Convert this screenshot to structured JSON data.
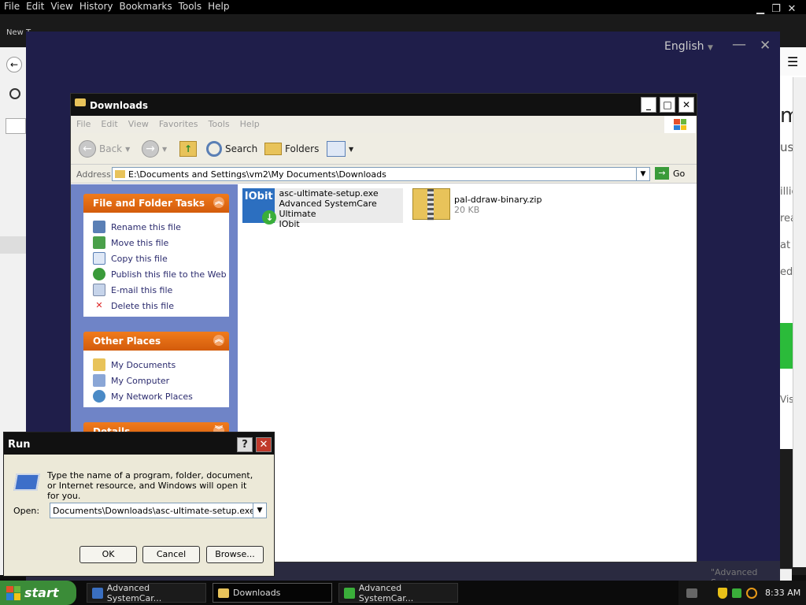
{
  "browser": {
    "menu": [
      "File",
      "Edit",
      "View",
      "History",
      "Bookmarks",
      "Tools",
      "Help"
    ],
    "new_tab_label": "New T"
  },
  "installer": {
    "language": "English",
    "language_arrow": "▼",
    "minimize": "—",
    "close": "✕"
  },
  "explorer": {
    "title": "Downloads",
    "menu": [
      "File",
      "Edit",
      "View",
      "Favorites",
      "Tools",
      "Help"
    ],
    "toolbar": {
      "back": "Back",
      "search": "Search",
      "folders": "Folders"
    },
    "address_label": "Address",
    "address_value": "E:\\Documents and Settings\\vm2\\My Documents\\Downloads",
    "go_label": "Go",
    "file_tasks": {
      "title": "File and Folder Tasks",
      "items": [
        "Rename this file",
        "Move this file",
        "Copy this file",
        "Publish this file to the Web",
        "E-mail this file",
        "Delete this file"
      ]
    },
    "other_places": {
      "title": "Other Places",
      "items": [
        "My Documents",
        "My Computer",
        "My Network Places"
      ]
    },
    "details_title": "Details",
    "files": [
      {
        "name": "asc-ultimate-setup.exe",
        "line2": "Advanced SystemCare Ultimate",
        "line3": "IObit",
        "icon_text": "IObit"
      },
      {
        "name": "pal-ddraw-binary.zip",
        "line2": "20 KB"
      }
    ]
  },
  "run_dialog": {
    "title": "Run",
    "help": "?",
    "close": "✕",
    "message": "Type the name of a program, folder, document, or Internet resource, and Windows will open it for you.",
    "open_label": "Open:",
    "open_value": "Documents\\Downloads\\asc-ultimate-setup.exe\" /qu",
    "ok": "OK",
    "cancel": "Cancel",
    "browse": "Browse..."
  },
  "taskbar": {
    "start": "start",
    "items": [
      "Advanced SystemCar...",
      "Downloads",
      "Advanced SystemCar..."
    ],
    "clock": "8:33 AM"
  },
  "page_fragments": {
    "right": [
      "m",
      "us",
      "illic",
      "rea",
      "at",
      "ed",
      "Vis"
    ],
    "bottom": "\"Advanced Syste"
  },
  "colors": {
    "installer_bg": "#1f1e4a",
    "xp_orange": "#e46a14",
    "start_green": "#3b8c38"
  }
}
